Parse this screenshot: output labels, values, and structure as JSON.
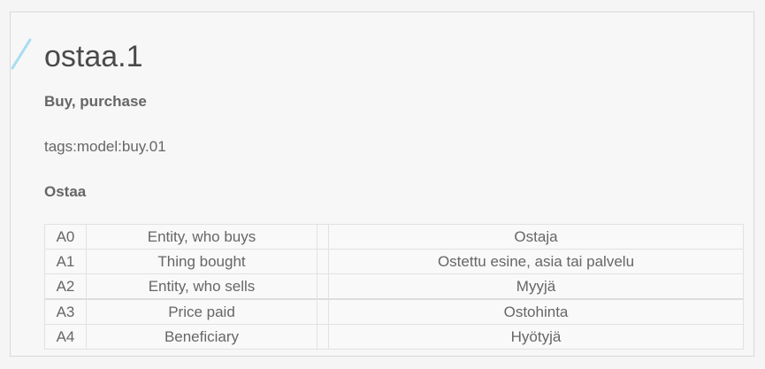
{
  "page": {
    "title": "ostaa.1",
    "subtitle": "Buy, purchase",
    "tags": "tags:model:buy.01",
    "section_heading": "Ostaa"
  },
  "roles_table": {
    "rows": [
      {
        "arg": "A0",
        "description": "Entity, who buys",
        "finnish": "Ostaja"
      },
      {
        "arg": "A1",
        "description": "Thing bought",
        "finnish": "Ostettu esine, asia tai palvelu"
      },
      {
        "arg": "A2",
        "description": "Entity, who sells",
        "finnish": "Myyjä"
      },
      {
        "arg": "A3",
        "description": "Price paid",
        "finnish": "Ostohinta"
      },
      {
        "arg": "A4",
        "description": "Beneficiary",
        "finnish": "Hyötyjä"
      }
    ]
  },
  "colors": {
    "accent": "#a8dcf2",
    "border": "#d8d8d8",
    "text": "#666666"
  },
  "icons": {
    "title_accent": "slash-accent-icon"
  }
}
